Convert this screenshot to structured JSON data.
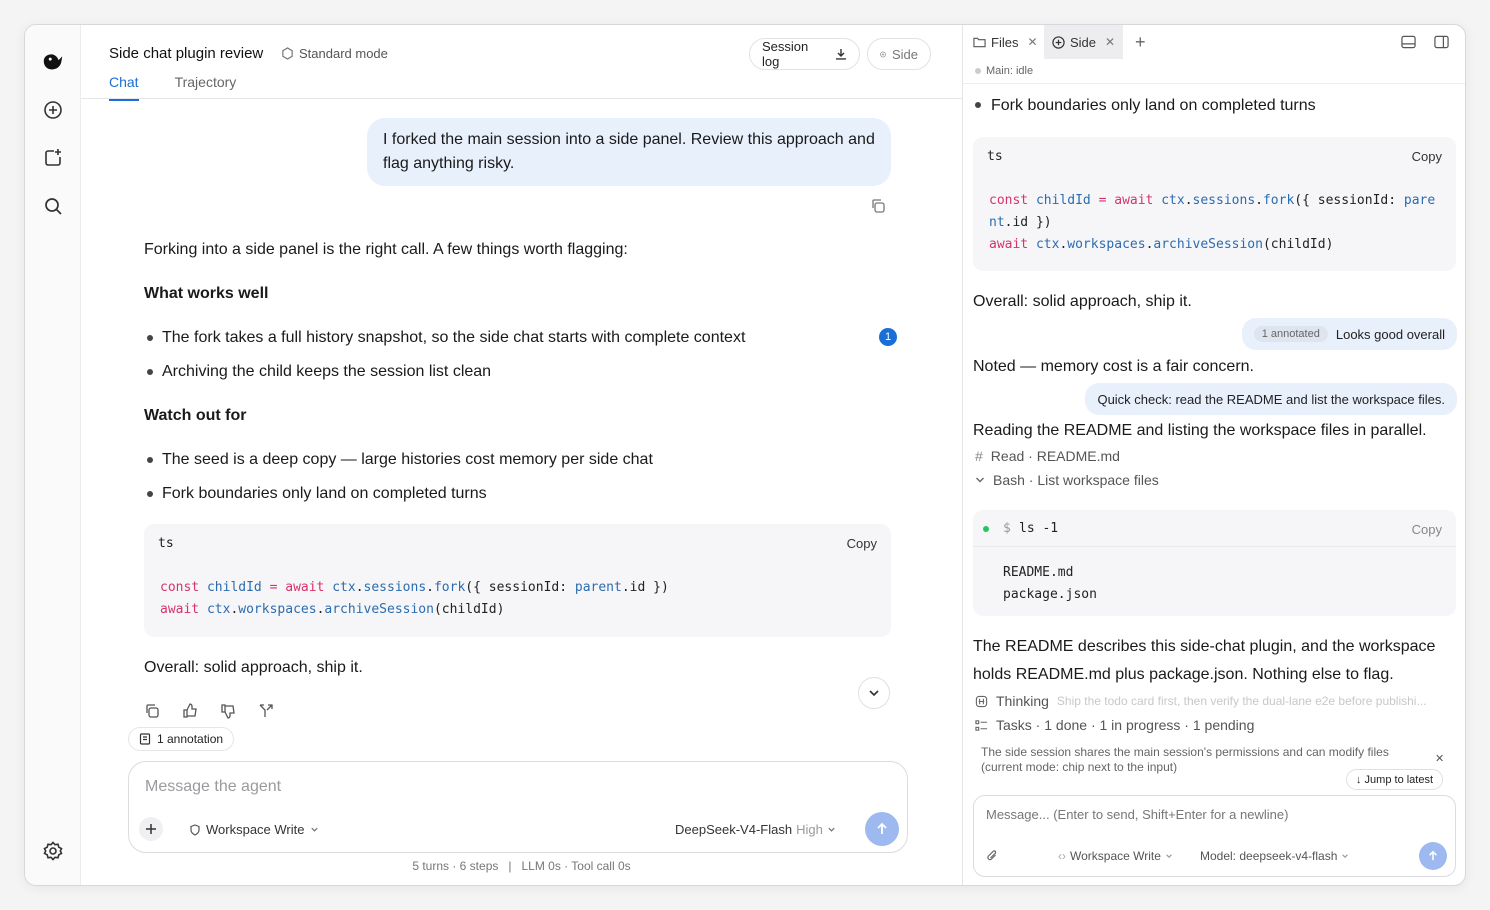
{
  "header": {
    "title": "Side chat plugin review",
    "mode": "Standard mode",
    "session_log": "Session log",
    "side": "Side",
    "tabs": [
      "Chat",
      "Trajectory"
    ]
  },
  "chat": {
    "user_message": "I forked the main session into a side panel. Review this approach and flag anything risky.",
    "intro": "Forking into a side panel is the right call. A few things worth flagging:",
    "works_heading": "What works well",
    "works": [
      "The fork takes a full history snapshot, so the side chat starts with complete context",
      "Archiving the child keeps the session list clean"
    ],
    "annotation_count_badge": "1",
    "watch_heading": "Watch out for",
    "watch": [
      "The seed is a deep copy — large histories cost memory per side chat",
      "Fork boundaries only land on completed turns"
    ],
    "code_lang": "ts",
    "code_copy": "Copy",
    "summary": "Overall: solid approach, ship it.",
    "annotation_chip": "1 annotation"
  },
  "composer": {
    "placeholder": "Message the agent",
    "permission": "Workspace Write",
    "model": "DeepSeek-V4-Flash",
    "effort": "High"
  },
  "footer": {
    "stats": "5 turns · 6 steps   |   LLM 0s · Tool call 0s"
  },
  "side_panel": {
    "tabs": [
      "Files",
      "Side"
    ],
    "status": "Main: idle",
    "bullet": "Fork boundaries only land on completed turns",
    "code_lang": "ts",
    "code_copy": "Copy",
    "summary": "Overall: solid approach, ship it.",
    "annot_badge": "1 annotated",
    "annot_text": "Looks good overall",
    "noted": "Noted — memory cost is a fair concern.",
    "quick_check": "Quick check: read the README and list the workspace files.",
    "reading": "Reading the README and listing the workspace files in parallel.",
    "tool_read": "Read · README.md",
    "tool_bash": "Bash · List workspace files",
    "shell_cmd": "ls -1",
    "shell_prompt": "$",
    "shell_copy": "Copy",
    "shell_out": [
      "README.md",
      "package.json"
    ],
    "conclusion": "The README describes this side-chat plugin, and the workspace holds README.md plus package.json. Nothing else to flag.",
    "thinking_label": "Thinking",
    "thinking_preview": "Ship the todo card first, then verify the dual-lane e2e before publishi...",
    "tasks": "Tasks · 1 done · 1 in progress · 1 pending",
    "notice": "The side session shares the main session's permissions and can modify files (current mode: chip next to the input)",
    "jump": "↓ Jump to latest",
    "composer_placeholder": "Message... (Enter to send, Shift+Enter for a newline)",
    "composer_permission": "Workspace Write",
    "composer_model": "Model: deepseek-v4-flash"
  },
  "colors": {
    "accent": "#1a6fd6",
    "user_bubble": "#e8f0fc",
    "send_button": "#9db9ef"
  }
}
